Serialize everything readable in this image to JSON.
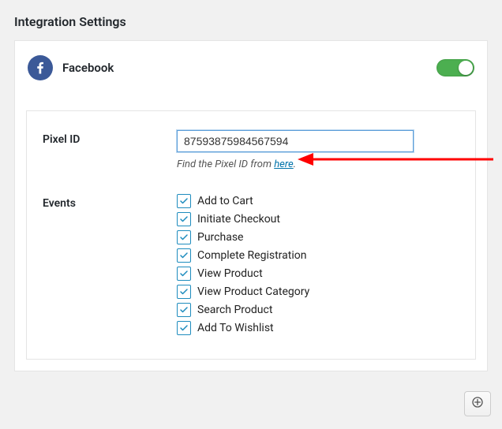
{
  "page_title": "Integration Settings",
  "integration": {
    "name": "Facebook",
    "enabled": true
  },
  "fields": {
    "pixel_id": {
      "label": "Pixel ID",
      "value": "87593875984567594",
      "hint_prefix": "Find the Pixel ID from ",
      "hint_link_text": "here",
      "hint_suffix": "."
    },
    "events": {
      "label": "Events",
      "items": [
        {
          "label": "Add to Cart",
          "checked": true
        },
        {
          "label": "Initiate Checkout",
          "checked": true
        },
        {
          "label": "Purchase",
          "checked": true
        },
        {
          "label": "Complete Registration",
          "checked": true
        },
        {
          "label": "View Product",
          "checked": true
        },
        {
          "label": "View Product Category",
          "checked": true
        },
        {
          "label": "Search Product",
          "checked": true
        },
        {
          "label": "Add To Wishlist",
          "checked": true
        }
      ]
    }
  },
  "annotation": {
    "arrow_color": "#ff0000"
  }
}
